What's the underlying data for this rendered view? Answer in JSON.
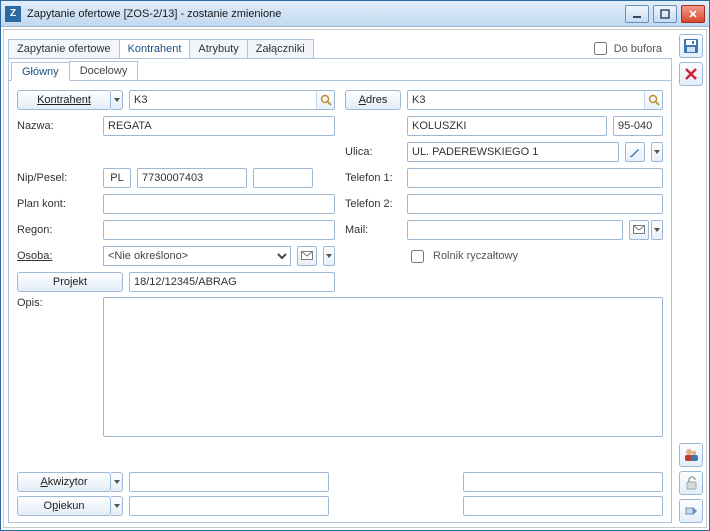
{
  "window": {
    "app_icon_letter": "Z",
    "title": "Zapytanie ofertowe [ZOS-2/13] - zostanie zmienione"
  },
  "outer_tabs": [
    "Zapytanie ofertowe",
    "Kontrahent",
    "Atrybuty",
    "Załączniki"
  ],
  "outer_tabs_active_index": 1,
  "bufora_label": "Do bufora",
  "bufora_checked": false,
  "inner_tabs": [
    "Główny",
    "Docelowy"
  ],
  "inner_tabs_active_index": 0,
  "left": {
    "kontrahent_btn": "Kontrahent",
    "kontrahent_value": "K3",
    "nazwa_label": "Nazwa:",
    "nazwa_value": "REGATA",
    "nip_label": "Nip/Pesel:",
    "nip_country": "PL",
    "nip_value": "7730007403",
    "nip_extra": "",
    "plan_label": "Plan kont:",
    "plan_value": "",
    "regon_label": "Regon:",
    "regon_value": "",
    "osoba_label": "Osoba:",
    "osoba_value": "<Nie określono>",
    "projekt_btn": "Projekt",
    "projekt_value": "18/12/12345/ABRAG",
    "opis_label": "Opis:",
    "opis_value": ""
  },
  "right": {
    "adres_btn": "Adres",
    "adres_value": "K3",
    "city_value": "KOLUSZKI",
    "postcode_value": "95-040",
    "ulica_label": "Ulica:",
    "ulica_value": "UL. PADEREWSKIEGO 1",
    "tel1_label": "Telefon 1:",
    "tel1_value": "",
    "tel2_label": "Telefon 2:",
    "tel2_value": "",
    "mail_label": "Mail:",
    "mail_value": "",
    "rolnik_label": "Rolnik ryczałtowy",
    "rolnik_checked": false
  },
  "footer": {
    "akwizytor_btn": "Akwizytor",
    "akwizytor_value": "",
    "akwizytor_right": "",
    "opiekun_btn": "Opiekun",
    "opiekun_value": "",
    "opiekun_right": ""
  }
}
